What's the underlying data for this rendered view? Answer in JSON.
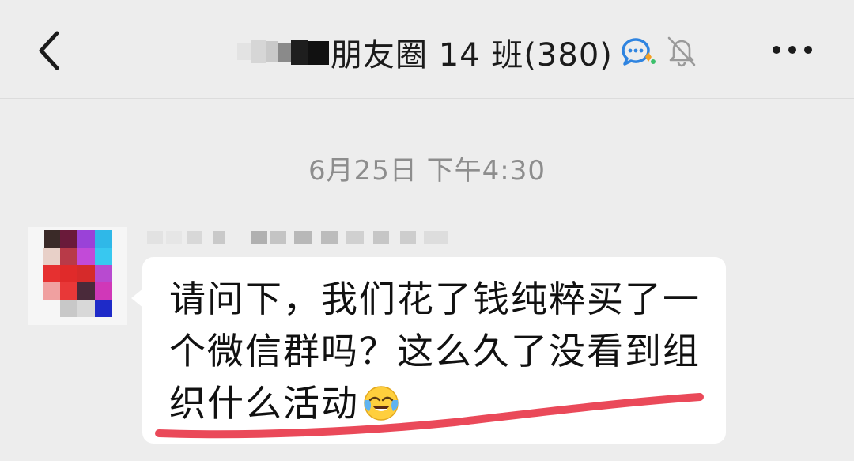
{
  "header": {
    "title": "朋友圈 14 班(380)",
    "icons": {
      "back": "chevron-left-icon",
      "badge": "group-chat-badge-icon",
      "mute": "muted-bell-icon",
      "more": "more-dots-icon"
    }
  },
  "chat": {
    "timestamp": "6月25日 下午4:30",
    "messages": [
      {
        "sender_avatar": "pixelated-avatar",
        "text_lines": [
          "请问下，我们花了钱纯粹买了一",
          "个微信群吗？这么久了没看到组",
          "织什么活动"
        ],
        "emoji": "tears-of-joy-emoji"
      }
    ]
  },
  "colors": {
    "background": "#ededed",
    "bubble": "#ffffff",
    "timestamp": "#8d8d8d",
    "annotation": "#e8394b",
    "badge_blue": "#2f84e0",
    "badge_green": "#3cc06b",
    "badge_orange": "#f3a125"
  }
}
